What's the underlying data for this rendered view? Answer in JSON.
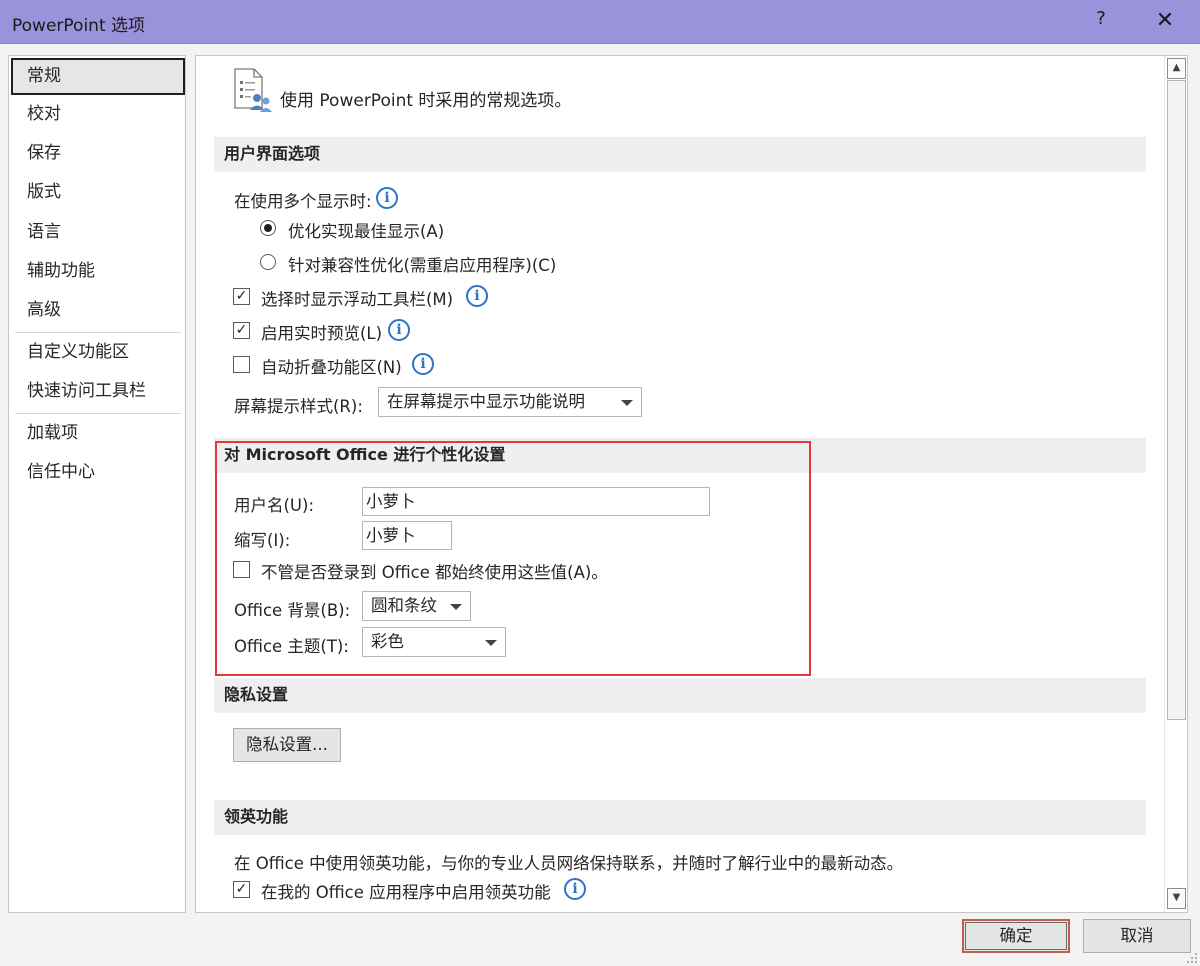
{
  "window": {
    "title": "PowerPoint 选项",
    "help_label": "?",
    "close_label": "✕"
  },
  "sidebar": {
    "items": [
      {
        "label": "常规",
        "selected": true
      },
      {
        "label": "校对"
      },
      {
        "label": "保存"
      },
      {
        "label": "版式"
      },
      {
        "label": "语言"
      },
      {
        "label": "辅助功能"
      },
      {
        "label": "高级"
      },
      {
        "label": "自定义功能区"
      },
      {
        "label": "快速访问工具栏"
      },
      {
        "label": "加载项"
      },
      {
        "label": "信任中心"
      }
    ]
  },
  "content": {
    "header": "使用 PowerPoint 时采用的常规选项。",
    "ui_options": {
      "title": "用户界面选项",
      "multi_display_label": "在使用多个显示时:",
      "radio_best": "优化实现最佳显示(A)",
      "radio_best_selected": true,
      "radio_compat": "针对兼容性优化(需重启应用程序)(C)",
      "check_minitoolbar": "选择时显示浮动工具栏(M)",
      "check_minitoolbar_checked": true,
      "check_livepreview": "启用实时预览(L)",
      "check_livepreview_checked": true,
      "check_collapse_ribbon": "自动折叠功能区(N)",
      "check_collapse_ribbon_checked": false,
      "screentip_label": "屏幕提示样式(R):",
      "screentip_value": "在屏幕提示中显示功能说明"
    },
    "personalize": {
      "title": "对 Microsoft Office 进行个性化设置",
      "username_label": "用户名(U):",
      "username_value": "小萝卜",
      "initials_label": "缩写(I):",
      "initials_value": "小萝卜",
      "always_use_label": "不管是否登录到 Office 都始终使用这些值(A)。",
      "always_use_checked": false,
      "background_label": "Office 背景(B):",
      "background_value": "圆和条纹",
      "theme_label": "Office 主题(T):",
      "theme_value": "彩色"
    },
    "privacy": {
      "title": "隐私设置",
      "button_label": "隐私设置..."
    },
    "linkedin": {
      "title": "领英功能",
      "description": "在 Office 中使用领英功能，与你的专业人员网络保持联系，并随时了解行业中的最新动态。",
      "enable_label": "在我的 Office 应用程序中启用领英功能",
      "enable_checked": true
    }
  },
  "footer": {
    "ok_label": "确定",
    "cancel_label": "取消"
  },
  "colors": {
    "titlebar": "#9b92dc",
    "info_icon": "#2e74c4",
    "highlight": "#e53935"
  }
}
